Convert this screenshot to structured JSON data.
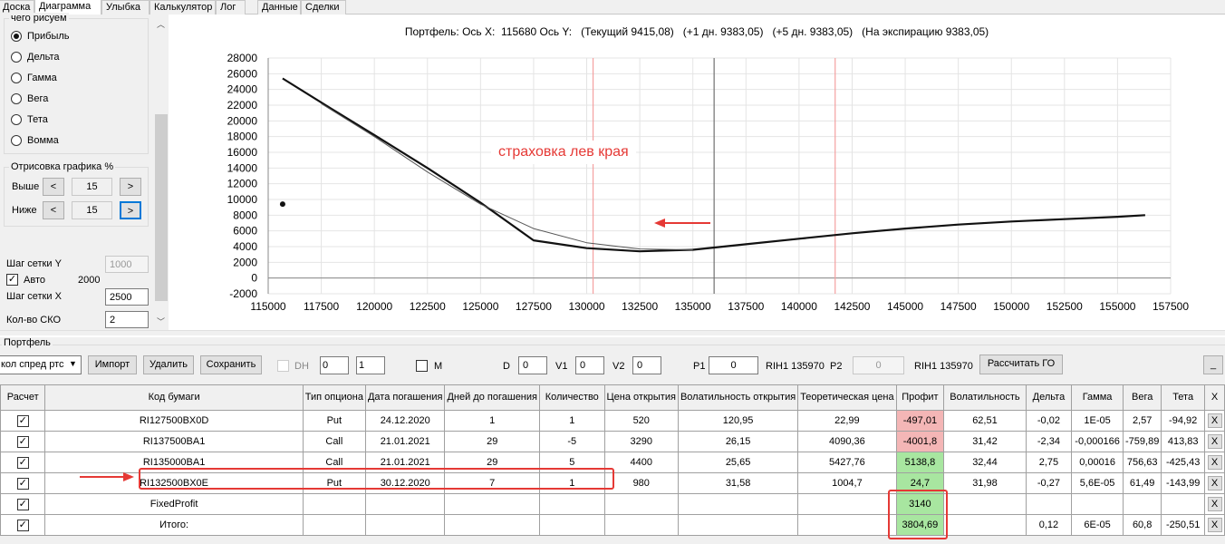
{
  "tabs": [
    "Доска",
    "Диаграмма",
    "Улыбка",
    "Калькулятор",
    "Лог",
    "Данные",
    "Сделки"
  ],
  "draw_group": {
    "title": "чего рисуем",
    "options": [
      "Прибыль",
      "Дельта",
      "Гамма",
      "Вега",
      "Тета",
      "Вомма"
    ],
    "selected": "Прибыль"
  },
  "render_group": {
    "title": "Отрисовка графика %",
    "above_label": "Выше",
    "below_label": "Ниже",
    "above_value": "15",
    "below_value": "15",
    "dec": "<",
    "inc": ">"
  },
  "grid": {
    "y_label": "Шаг сетки Y",
    "y_value": "1000",
    "auto_label": "Авто",
    "auto_value": "2000",
    "x_label": "Шаг сетки X",
    "x_value": "2500",
    "sko_label": "Кол-во СКО",
    "sko_value": "2"
  },
  "chart": {
    "header": "Портфель: Ось X:  115680 Ось Y:   (Текущий 9415,08)   (+1 дн. 9383,05)   (+5 дн. 9383,05)   (На экспирацию 9383,05)",
    "annotation": "страховка  лев края",
    "arrow_color": "#e53935"
  },
  "chart_data": {
    "type": "line",
    "xlim": [
      115000,
      157500
    ],
    "ylim": [
      -2000,
      28000
    ],
    "x_ticks": [
      "115000",
      "117500",
      "120000",
      "122500",
      "125000",
      "127500",
      "130000",
      "132500",
      "135000",
      "137500",
      "140000",
      "142500",
      "145000",
      "147500",
      "150000",
      "152500",
      "155000",
      "157500"
    ],
    "y_ticks": [
      "28000",
      "26000",
      "24000",
      "22000",
      "20000",
      "18000",
      "16000",
      "14000",
      "12000",
      "10000",
      "8000",
      "6000",
      "4000",
      "2000",
      "0",
      "-2000"
    ],
    "vlines": [
      {
        "x": 130300,
        "color": "#f4a0a0"
      },
      {
        "x": 136000,
        "color": "#707070"
      },
      {
        "x": 141700,
        "color": "#f4a0a0"
      }
    ],
    "point": {
      "x": 115680,
      "y": 9415
    },
    "series": [
      {
        "x": [
          115680,
          118000,
          120000,
          122500,
          125000,
          127500,
          130000,
          132500,
          135000,
          137500,
          140000,
          142500,
          145000,
          147500,
          150000,
          152500,
          155000,
          156300
        ],
        "y": [
          25400,
          21500,
          18200,
          14000,
          9600,
          4800,
          3800,
          3400,
          3600,
          4300,
          5000,
          5700,
          6300,
          6800,
          7200,
          7500,
          7800,
          8000
        ],
        "color": "#111",
        "width": 2.2
      },
      {
        "x": [
          117500,
          120000,
          122500,
          125000,
          127500,
          130000,
          132500,
          135000
        ],
        "y": [
          22200,
          18000,
          13500,
          9400,
          6300,
          4500,
          3700,
          3600
        ],
        "color": "#555",
        "width": 1
      }
    ]
  },
  "portfolio": {
    "title": "Портфель",
    "combo": "кол спред ртс",
    "import": "Импорт",
    "delete": "Удалить",
    "save": "Сохранить",
    "dh": "DH",
    "spin1": "0",
    "spin2": "1",
    "m": "M",
    "d_label": "D",
    "d_value": "0",
    "v1_label": "V1",
    "v1_value": "0",
    "v2_label": "V2",
    "v2_value": "0",
    "p1_label": "P1",
    "p1_value": "0",
    "p1_sec": "RIH1 135970",
    "p2_label": "P2",
    "p2_value": "0",
    "p2_sec": "RIH1 135970",
    "calc": "Рассчитать ГО",
    "minimize": "_"
  },
  "table": {
    "headers": [
      "Расчет",
      "Код бумаги",
      "Тип опциона",
      "Дата погашения",
      "Дней до погашения",
      "Количество",
      "Цена открытия",
      "Волатильность открытия",
      "Теоретическая цена",
      "Профит",
      "Волатильность",
      "Дельта",
      "Гамма",
      "Вега",
      "Тета",
      "X"
    ],
    "rows": [
      [
        "✓",
        "RI127500BX0D",
        "Put",
        "24.12.2020",
        "1",
        "1",
        "520",
        "120,95",
        "22,99",
        "-497,01",
        "62,51",
        "-0,02",
        "1E-05",
        "2,57",
        "-94,92",
        "X"
      ],
      [
        "✓",
        "RI137500BA1",
        "Call",
        "21.01.2021",
        "29",
        "-5",
        "3290",
        "26,15",
        "4090,36",
        "-4001,8",
        "31,42",
        "-2,34",
        "-0,000166",
        "-759,89",
        "413,83",
        "X"
      ],
      [
        "✓",
        "RI135000BA1",
        "Call",
        "21.01.2021",
        "29",
        "5",
        "4400",
        "25,65",
        "5427,76",
        "5138,8",
        "32,44",
        "2,75",
        "0,00016",
        "756,63",
        "-425,43",
        "X"
      ],
      [
        "✓",
        "RI132500BX0E",
        "Put",
        "30.12.2020",
        "7",
        "1",
        "980",
        "31,58",
        "1004,7",
        "24,7",
        "31,98",
        "-0,27",
        "5,6E-05",
        "61,49",
        "-143,99",
        "X"
      ],
      [
        "✓",
        "FixedProfit",
        "",
        "",
        "",
        "",
        "",
        "",
        "",
        "3140",
        "",
        "",
        "",
        "",
        "",
        "X"
      ],
      [
        "✓",
        "Итого:",
        "",
        "",
        "",
        "",
        "",
        "",
        "",
        "3804,69",
        "",
        "0,12",
        "6E-05",
        "60,8",
        "-250,51",
        "X"
      ]
    ],
    "profit_colors": [
      "#f4b6b6",
      "#f4b6b6",
      "#a8e6a0",
      "#a8e6a0",
      "#a8e6a0",
      "#a8e6a0"
    ]
  }
}
